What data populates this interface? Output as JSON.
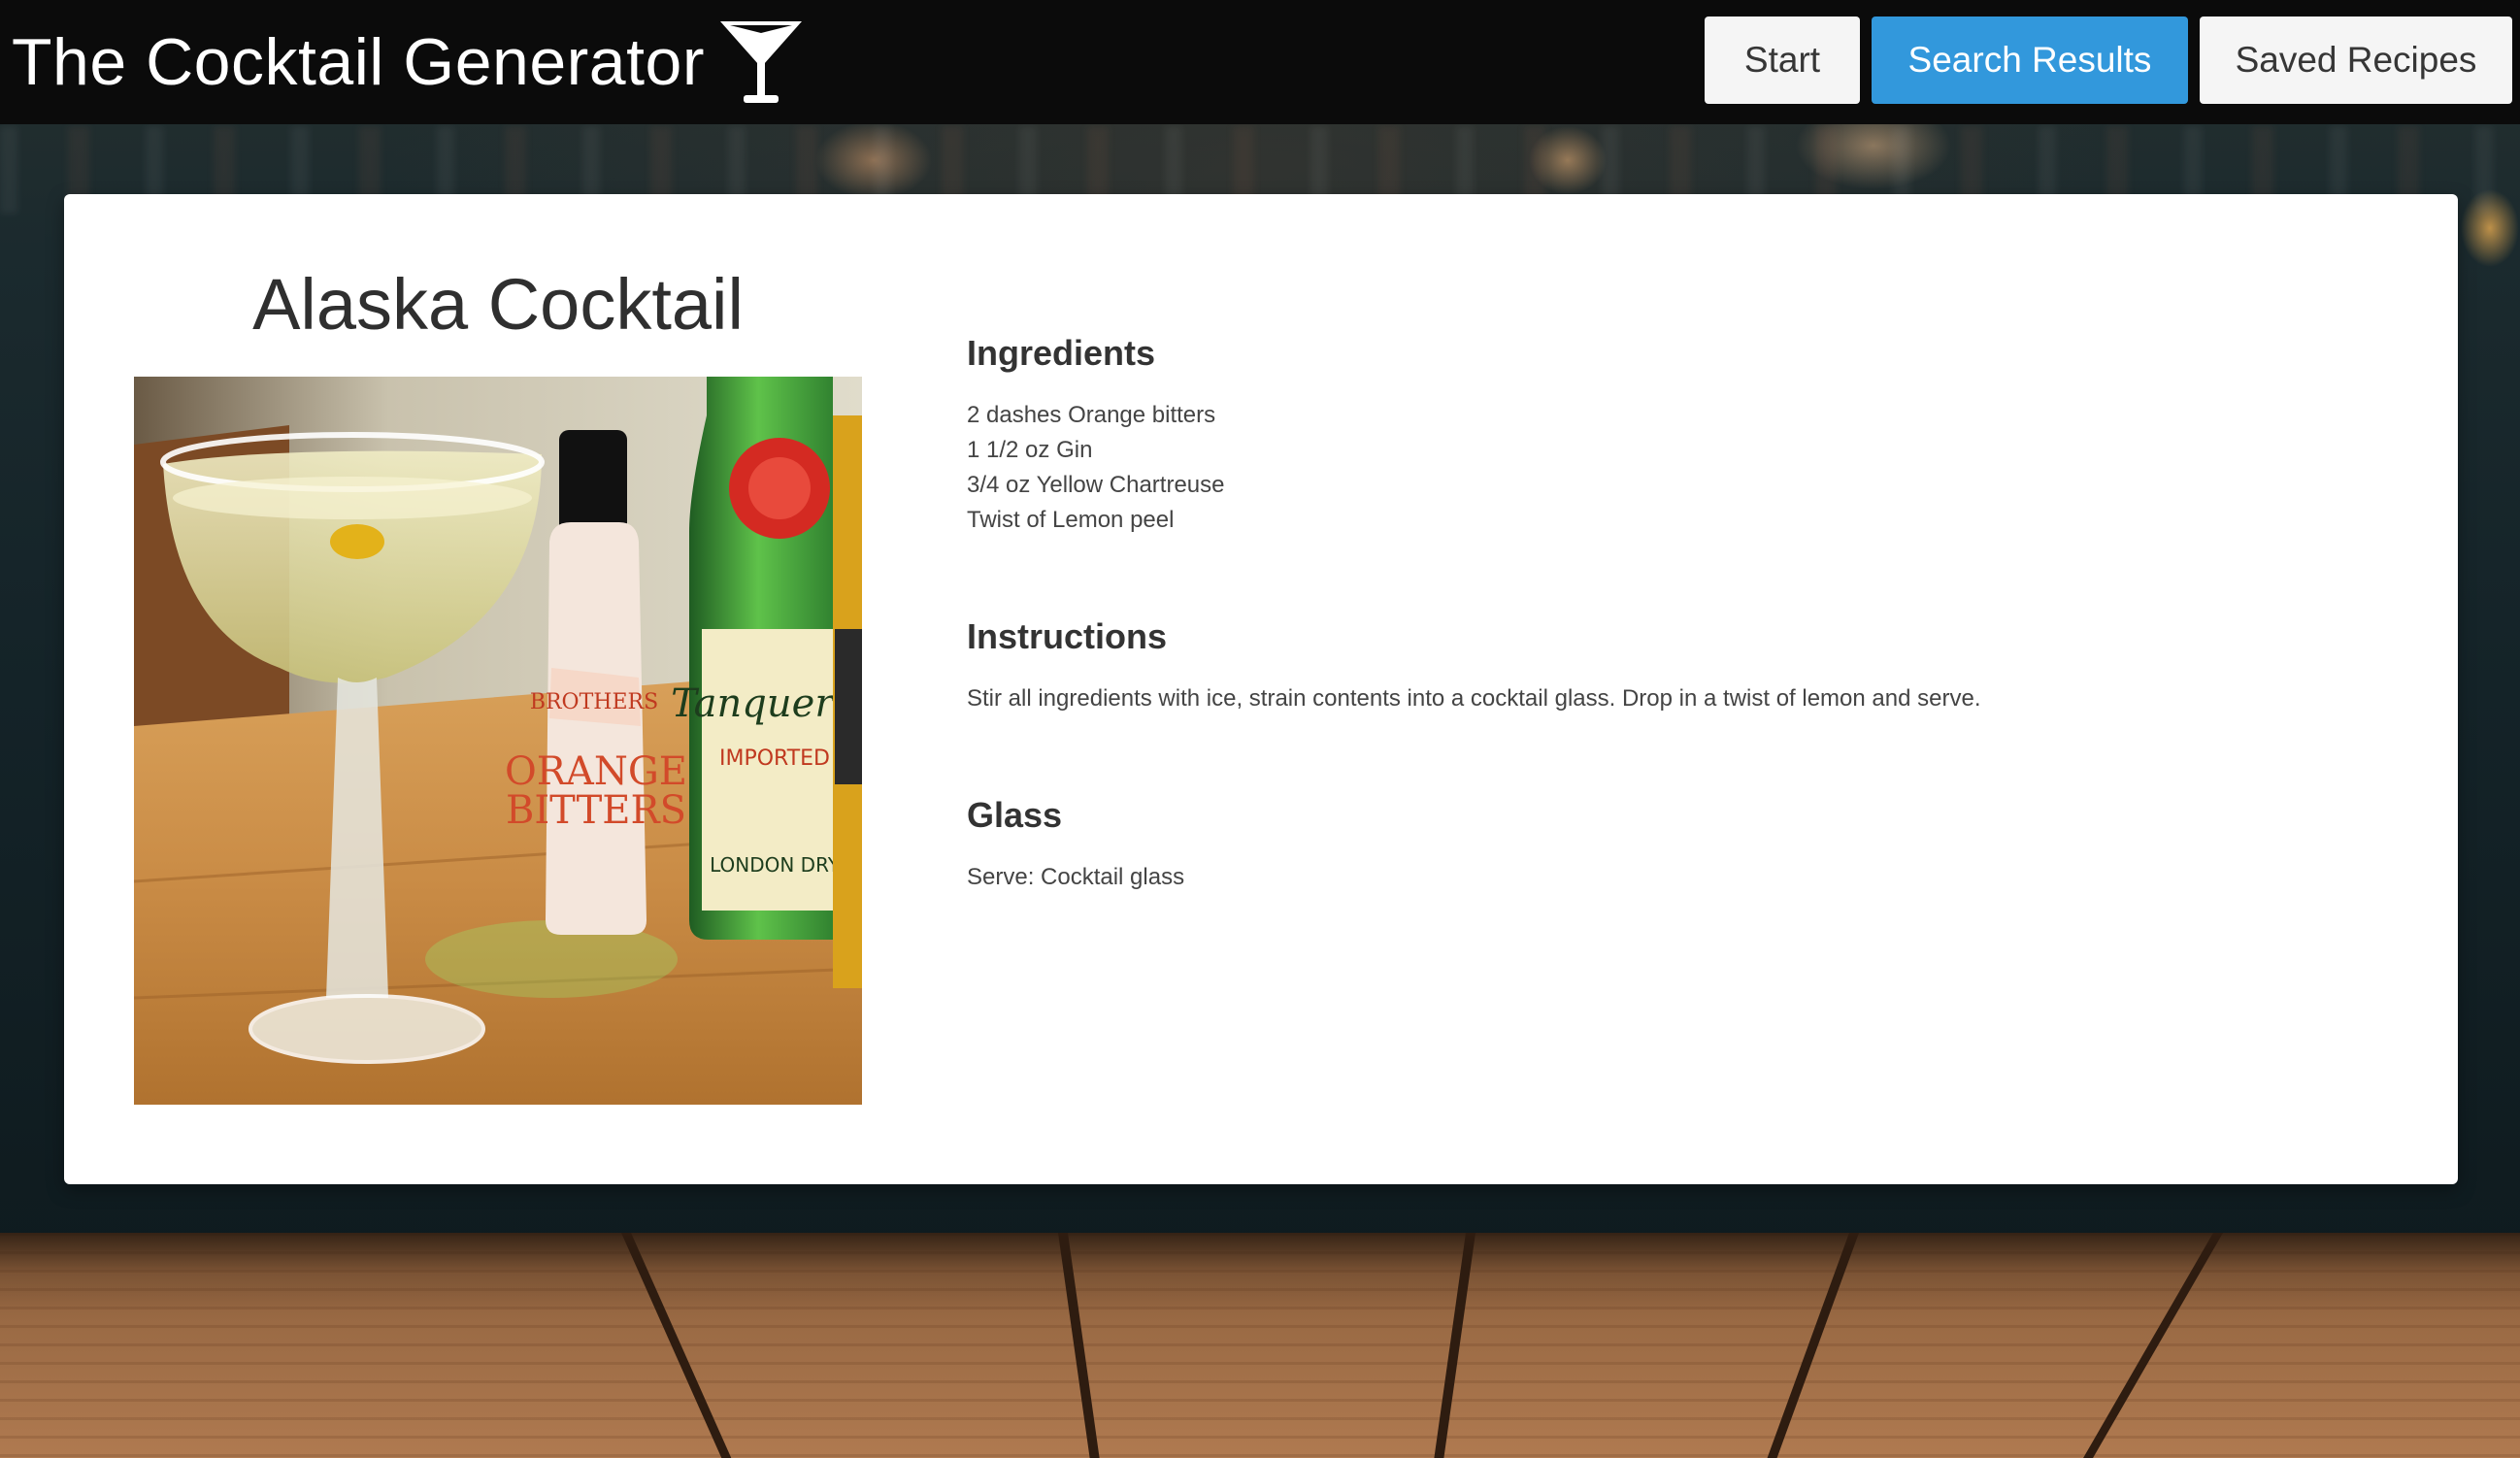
{
  "header": {
    "title": "The Cocktail Generator",
    "logo_icon": "martini-glass-icon"
  },
  "nav": {
    "start_label": "Start",
    "results_label": "Search Results",
    "saved_label": "Saved Recipes",
    "active_tab": "Search Results",
    "active_color": "#3298dc"
  },
  "recipe": {
    "name": "Alaska Cocktail",
    "ingredients_heading": "Ingredients",
    "ingredients": [
      "2 dashes Orange bitters",
      "1 1/2 oz Gin",
      "3/4 oz Yellow Chartreuse",
      "Twist of Lemon peel"
    ],
    "instructions_heading": "Instructions",
    "instructions": "Stir all ingredients with ice, strain contents into a cocktail glass. Drop in a twist of lemon and serve.",
    "glass_heading": "Glass",
    "glass": "Serve: Cocktail glass"
  },
  "photo": {
    "label_bitters_1": "BROTHERS",
    "label_bitters_2": "ORANGE",
    "label_bitters_3": "BITTERS",
    "label_gin_1": "Tanqueray",
    "label_gin_2": "IMPORTED",
    "label_gin_3": "LONDON DRY"
  }
}
